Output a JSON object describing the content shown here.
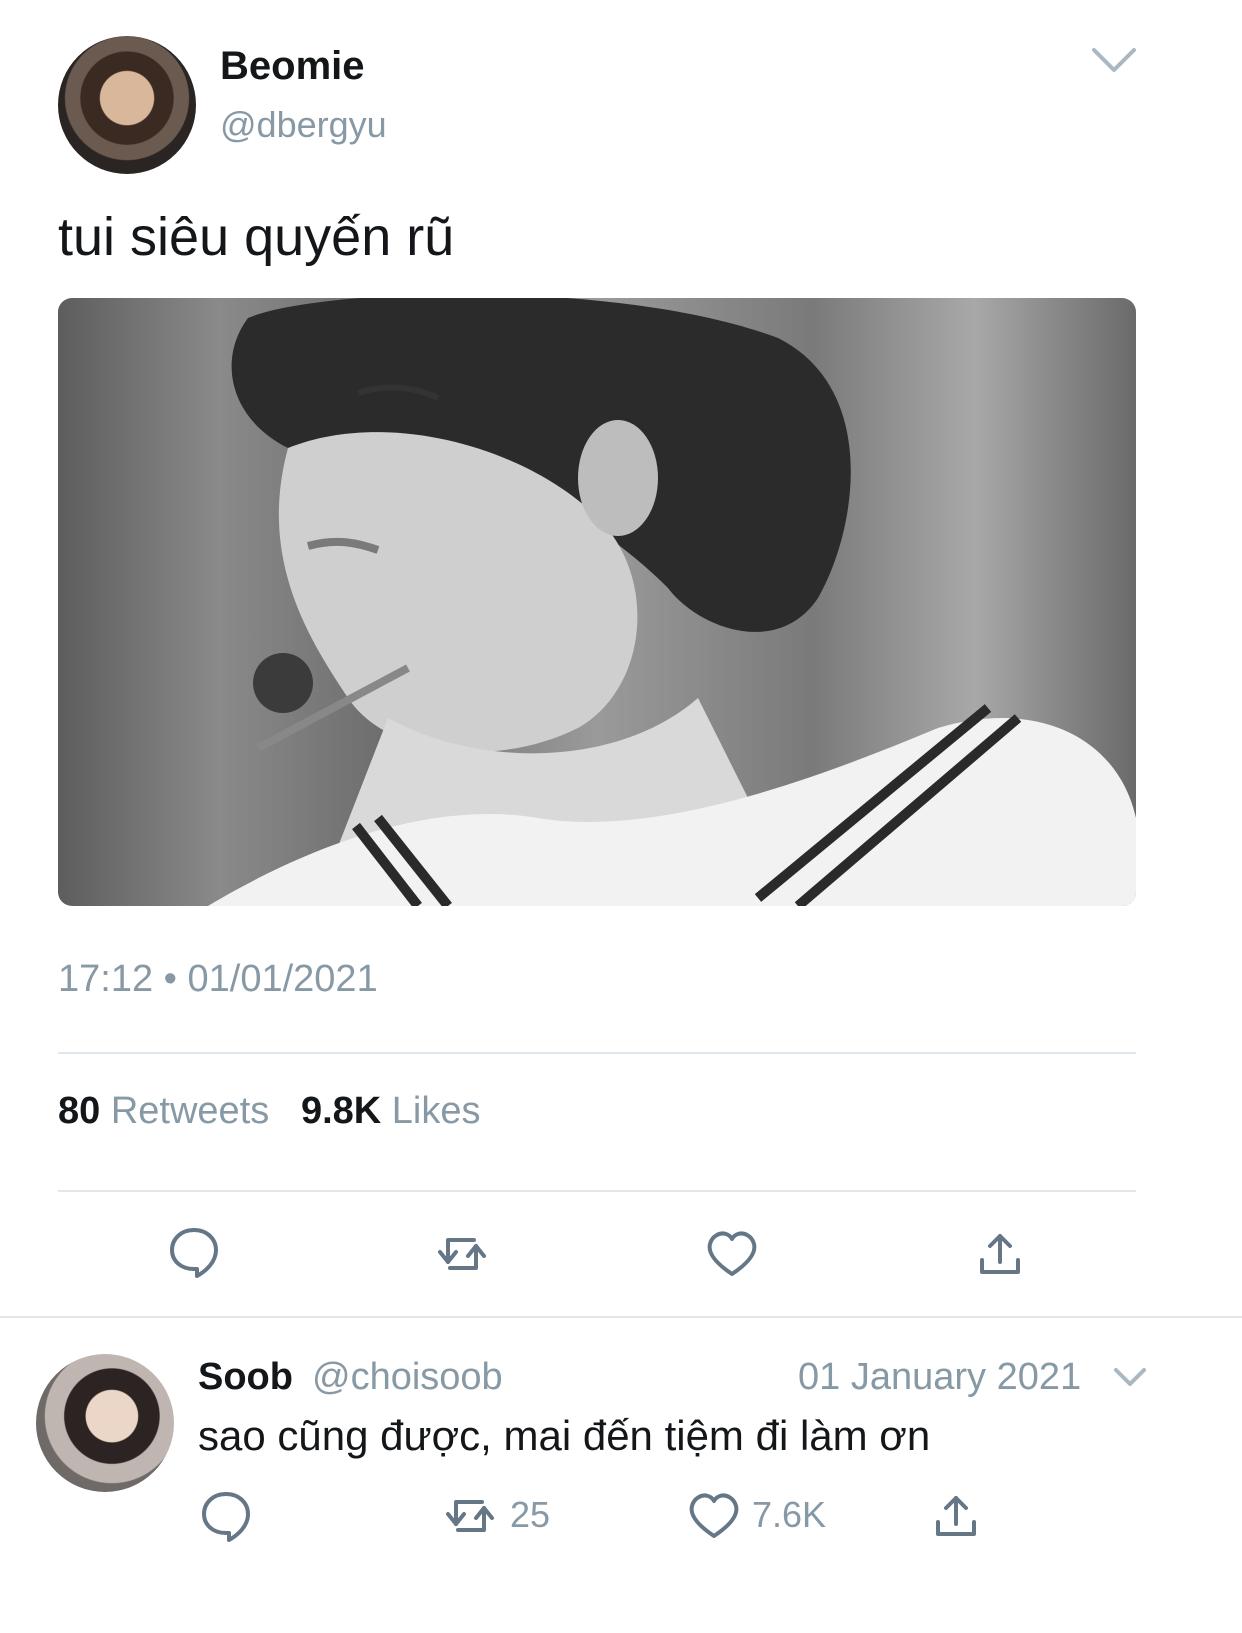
{
  "main_tweet": {
    "display_name": "Beomie",
    "handle": "@dbergyu",
    "text": "tui siêu quyến rũ",
    "timestamp": "17:12 • 01/01/2021",
    "retweets_count": "80",
    "retweets_label": "Retweets",
    "likes_count": "9.8K",
    "likes_label": "Likes",
    "icons": [
      "reply-icon",
      "retweet-icon",
      "like-icon",
      "share-icon"
    ]
  },
  "reply_tweet": {
    "display_name": "Soob",
    "handle": "@choisoob",
    "date": "01 January 2021",
    "text": "sao cũng được, mai đến tiệm đi làm ơn",
    "retweets_count": "25",
    "likes_count": "7.6K",
    "icons": [
      "reply-icon",
      "retweet-icon",
      "like-icon",
      "share-icon"
    ]
  },
  "colors": {
    "primary_text": "#14171a",
    "secondary_text": "#8899a6",
    "divider": "#e1e8ed"
  }
}
